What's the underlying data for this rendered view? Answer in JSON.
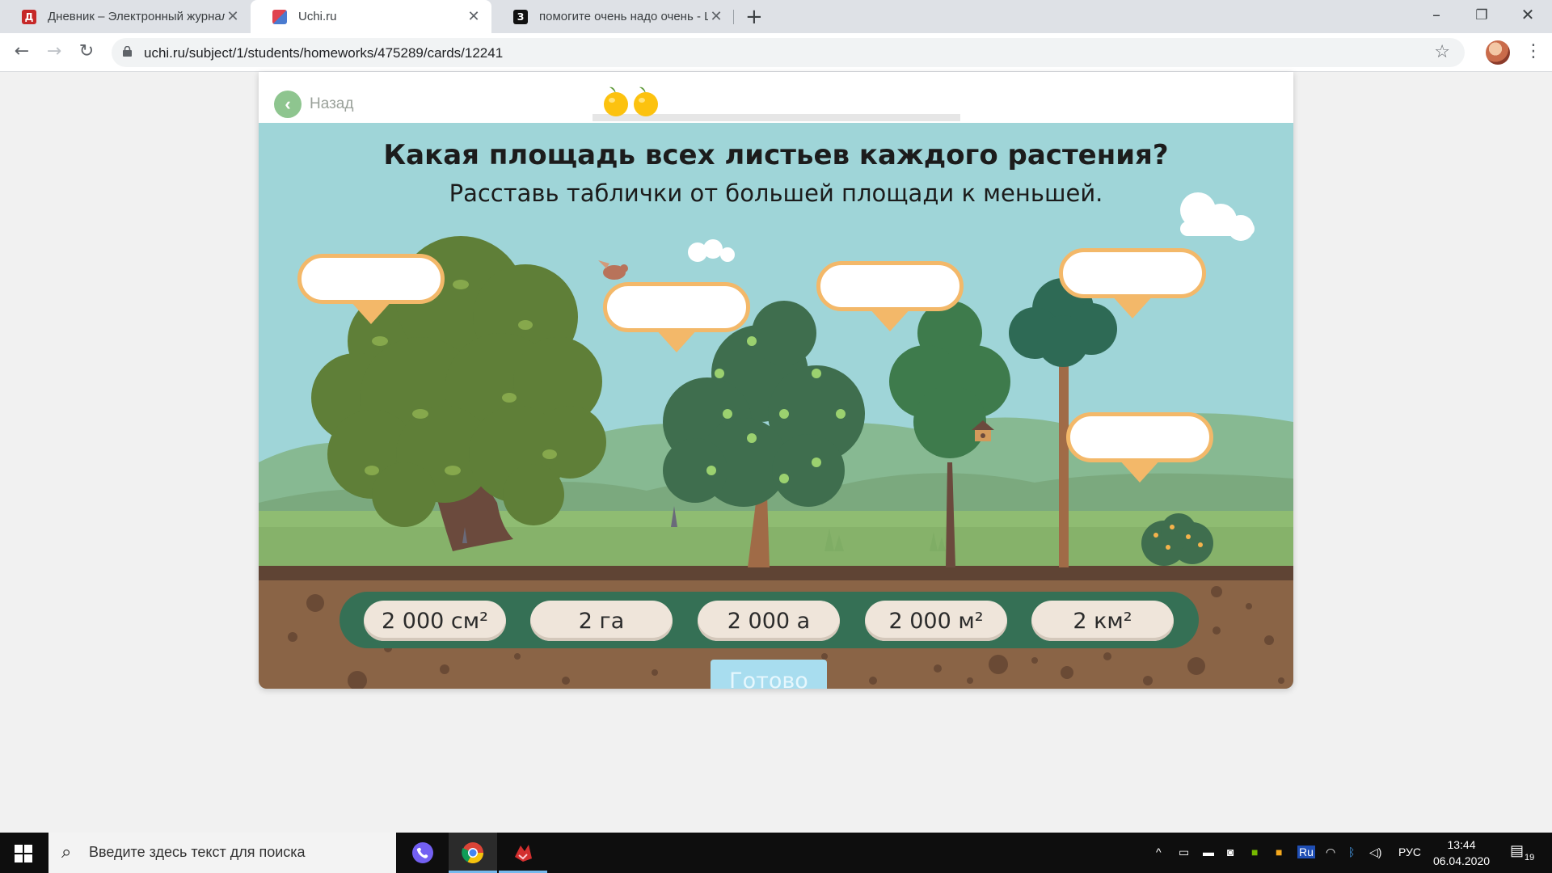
{
  "browser": {
    "tabs": [
      {
        "title": "Дневник – Электронный журнал",
        "favicon_color": "#c62828",
        "favicon_glyph": "Д"
      },
      {
        "title": "Uchi.ru",
        "favicon_color": "#d23c4a",
        "favicon_glyph": ""
      },
      {
        "title": "помогите очень надо очень - Школьные Знания",
        "favicon_color": "#111111",
        "favicon_glyph": "З"
      }
    ],
    "active_tab": 1,
    "new_tab_glyph": "+",
    "url": "uchi.ru/subject/1/students/homeworks/475289/cards/12241"
  },
  "game": {
    "back_label": "Назад",
    "question": "Какая площадь всех листьев каждого растения?",
    "instruction": "Расставь таблички от большей площади к меньшей.",
    "apples_earned": 2,
    "choices": [
      "2 000 см²",
      "2 га",
      "2 000 а",
      "2 000 м²",
      "2 км²"
    ],
    "done_label": "Готово",
    "colors": {
      "sky": "#9fd5d8",
      "soil": "#8a6446",
      "choice_bar": "#357055",
      "bubble_border": "#f3b869",
      "done_button": "#a8ddef"
    }
  },
  "taskbar": {
    "search_placeholder": "Введите здесь текст для поиска",
    "language": "РУС",
    "time": "13:44",
    "date": "06.04.2020",
    "notifications": "19"
  }
}
